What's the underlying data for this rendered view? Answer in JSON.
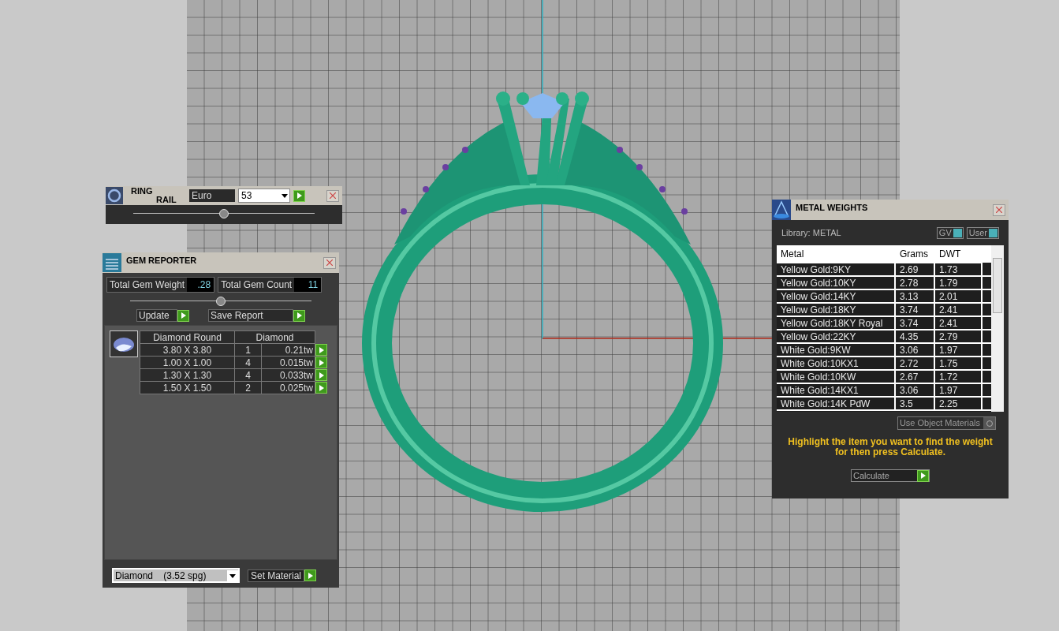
{
  "ring_rail": {
    "title_top": "RING",
    "title_bottom": "RAIL",
    "standard": "Euro",
    "size": "53",
    "slider": {
      "level": 0.5
    }
  },
  "gem_reporter": {
    "title": "GEM REPORTER",
    "total_weight": {
      "label": "Total Gem Weight",
      "value": ".28"
    },
    "total_count": {
      "label": "Total Gem Count",
      "value": "11"
    },
    "slider": {
      "level": 0.5
    },
    "buttons": [
      "Update",
      "Save Report"
    ],
    "table": {
      "columns": [
        "Diamond Round",
        "Diamond"
      ],
      "rows": [
        {
          "size": "3.80 X 3.80",
          "count": "1",
          "weight": "0.21tw"
        },
        {
          "size": "1.00 X 1.00",
          "count": "4",
          "weight": "0.015tw"
        },
        {
          "size": "1.30 X 1.30",
          "count": "4",
          "weight": "0.033tw"
        },
        {
          "size": "1.50 X 1.50",
          "count": "2",
          "weight": "0.025tw"
        }
      ]
    },
    "material": "Diamond    (3.52 spg)",
    "set_button": "Set Material"
  },
  "metal_weights": {
    "title": "METAL WEIGHTS",
    "library": "Library: METAL",
    "toggles": [
      {
        "label": "GV",
        "on": true
      },
      {
        "label": "User",
        "on": true
      }
    ],
    "columns": [
      "Metal",
      "Grams",
      "DWT"
    ],
    "rows": [
      {
        "metal": "Yellow Gold:9KY",
        "grams": "2.69",
        "dwt": "1.73"
      },
      {
        "metal": "Yellow Gold:10KY",
        "grams": "2.78",
        "dwt": "1.79"
      },
      {
        "metal": "Yellow Gold:14KY",
        "grams": "3.13",
        "dwt": "2.01"
      },
      {
        "metal": "Yellow Gold:18KY",
        "grams": "3.74",
        "dwt": "2.41"
      },
      {
        "metal": "Yellow Gold:18KY Royal",
        "grams": "3.74",
        "dwt": "2.41"
      },
      {
        "metal": "Yellow Gold:22KY",
        "grams": "4.35",
        "dwt": "2.79"
      },
      {
        "metal": "White Gold:9KW",
        "grams": "3.06",
        "dwt": "1.97"
      },
      {
        "metal": "White Gold:10KX1",
        "grams": "2.72",
        "dwt": "1.75"
      },
      {
        "metal": "White Gold:10KW",
        "grams": "2.67",
        "dwt": "1.72"
      },
      {
        "metal": "White Gold:14KX1",
        "grams": "3.06",
        "dwt": "1.97"
      },
      {
        "metal": "White Gold:14K PdW",
        "grams": "3.5",
        "dwt": "2.25"
      }
    ],
    "use_object_materials": {
      "label": "Use Object Materials",
      "on": false
    },
    "hint": "Highlight the item you want to find the weight for then press Calculate.",
    "calculate": "Calculate"
  }
}
